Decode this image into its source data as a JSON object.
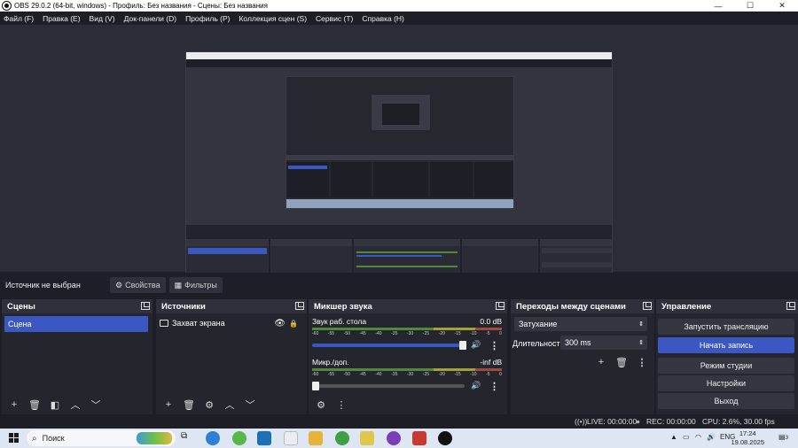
{
  "window": {
    "title": "OBS 29.0.2 (64-bit, windows) - Профиль: Без названия - Сцены: Без названия",
    "min": "—",
    "max": "☐",
    "close": "✕"
  },
  "menu": [
    "Файл (F)",
    "Правка (E)",
    "Вид (V)",
    "Док-панели (D)",
    "Профиль (P)",
    "Коллекция сцен (S)",
    "Сервис (T)",
    "Справка (H)"
  ],
  "source_bar": {
    "no_source": "Источник не выбран",
    "properties": "Свойства",
    "filters": "Фильтры"
  },
  "scenes": {
    "title": "Сцены",
    "items": [
      "Сцена"
    ]
  },
  "sources": {
    "title": "Источники",
    "items": [
      "Захват экрана"
    ]
  },
  "mixer": {
    "title": "Микшер звука",
    "ticks": [
      "-60",
      "-55",
      "-50",
      "-45",
      "-40",
      "-35",
      "-30",
      "-25",
      "-20",
      "-15",
      "-10",
      "-5",
      "0"
    ],
    "channels": [
      {
        "name": "Звук раб. стола",
        "db": "0.0 dB",
        "volume": 1.0
      },
      {
        "name": "Микр./доп.",
        "db": "-inf dB",
        "volume": 0.0
      }
    ]
  },
  "transitions": {
    "title": "Переходы между сценами",
    "selected": "Затухание",
    "duration_label": "Длительность",
    "duration_value": "300 ms"
  },
  "controls": {
    "title": "Управление",
    "start_stream": "Запустить трансляцию",
    "start_record": "Начать запись",
    "studio_mode": "Режим студии",
    "settings": "Настройки",
    "exit": "Выход"
  },
  "status": {
    "live": "LIVE: 00:00:00",
    "rec": "REC: 00:00:00",
    "cpu": "CPU: 2.6%, 30.00 fps"
  },
  "taskbar": {
    "search": "Поиск",
    "lang": "ENG",
    "time": "17:24",
    "date": "19.08.2025",
    "notifications": "3"
  },
  "colors": {
    "accent": "#3b57c3",
    "panel": "#2a2b34",
    "background": "#1e1f26"
  }
}
